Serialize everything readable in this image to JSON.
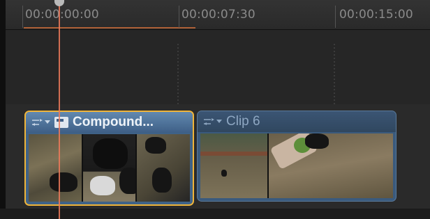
{
  "ruler": {
    "timecodes": [
      "00:00:00:00",
      "00:00:07:30",
      "00:00:15:00"
    ]
  },
  "clips": {
    "compound": {
      "title": "Compound...",
      "selected": true,
      "border_color": "#f0b53a"
    },
    "clip6": {
      "title": "Clip 6",
      "selected": false
    }
  },
  "colors": {
    "playhead": "#f07a5a",
    "clip_header": "#5a7fa6",
    "selection": "#f0b53a"
  },
  "icons": {
    "roles_menu": "roles-menu-icon",
    "compound_clip": "compound-clip-icon"
  }
}
